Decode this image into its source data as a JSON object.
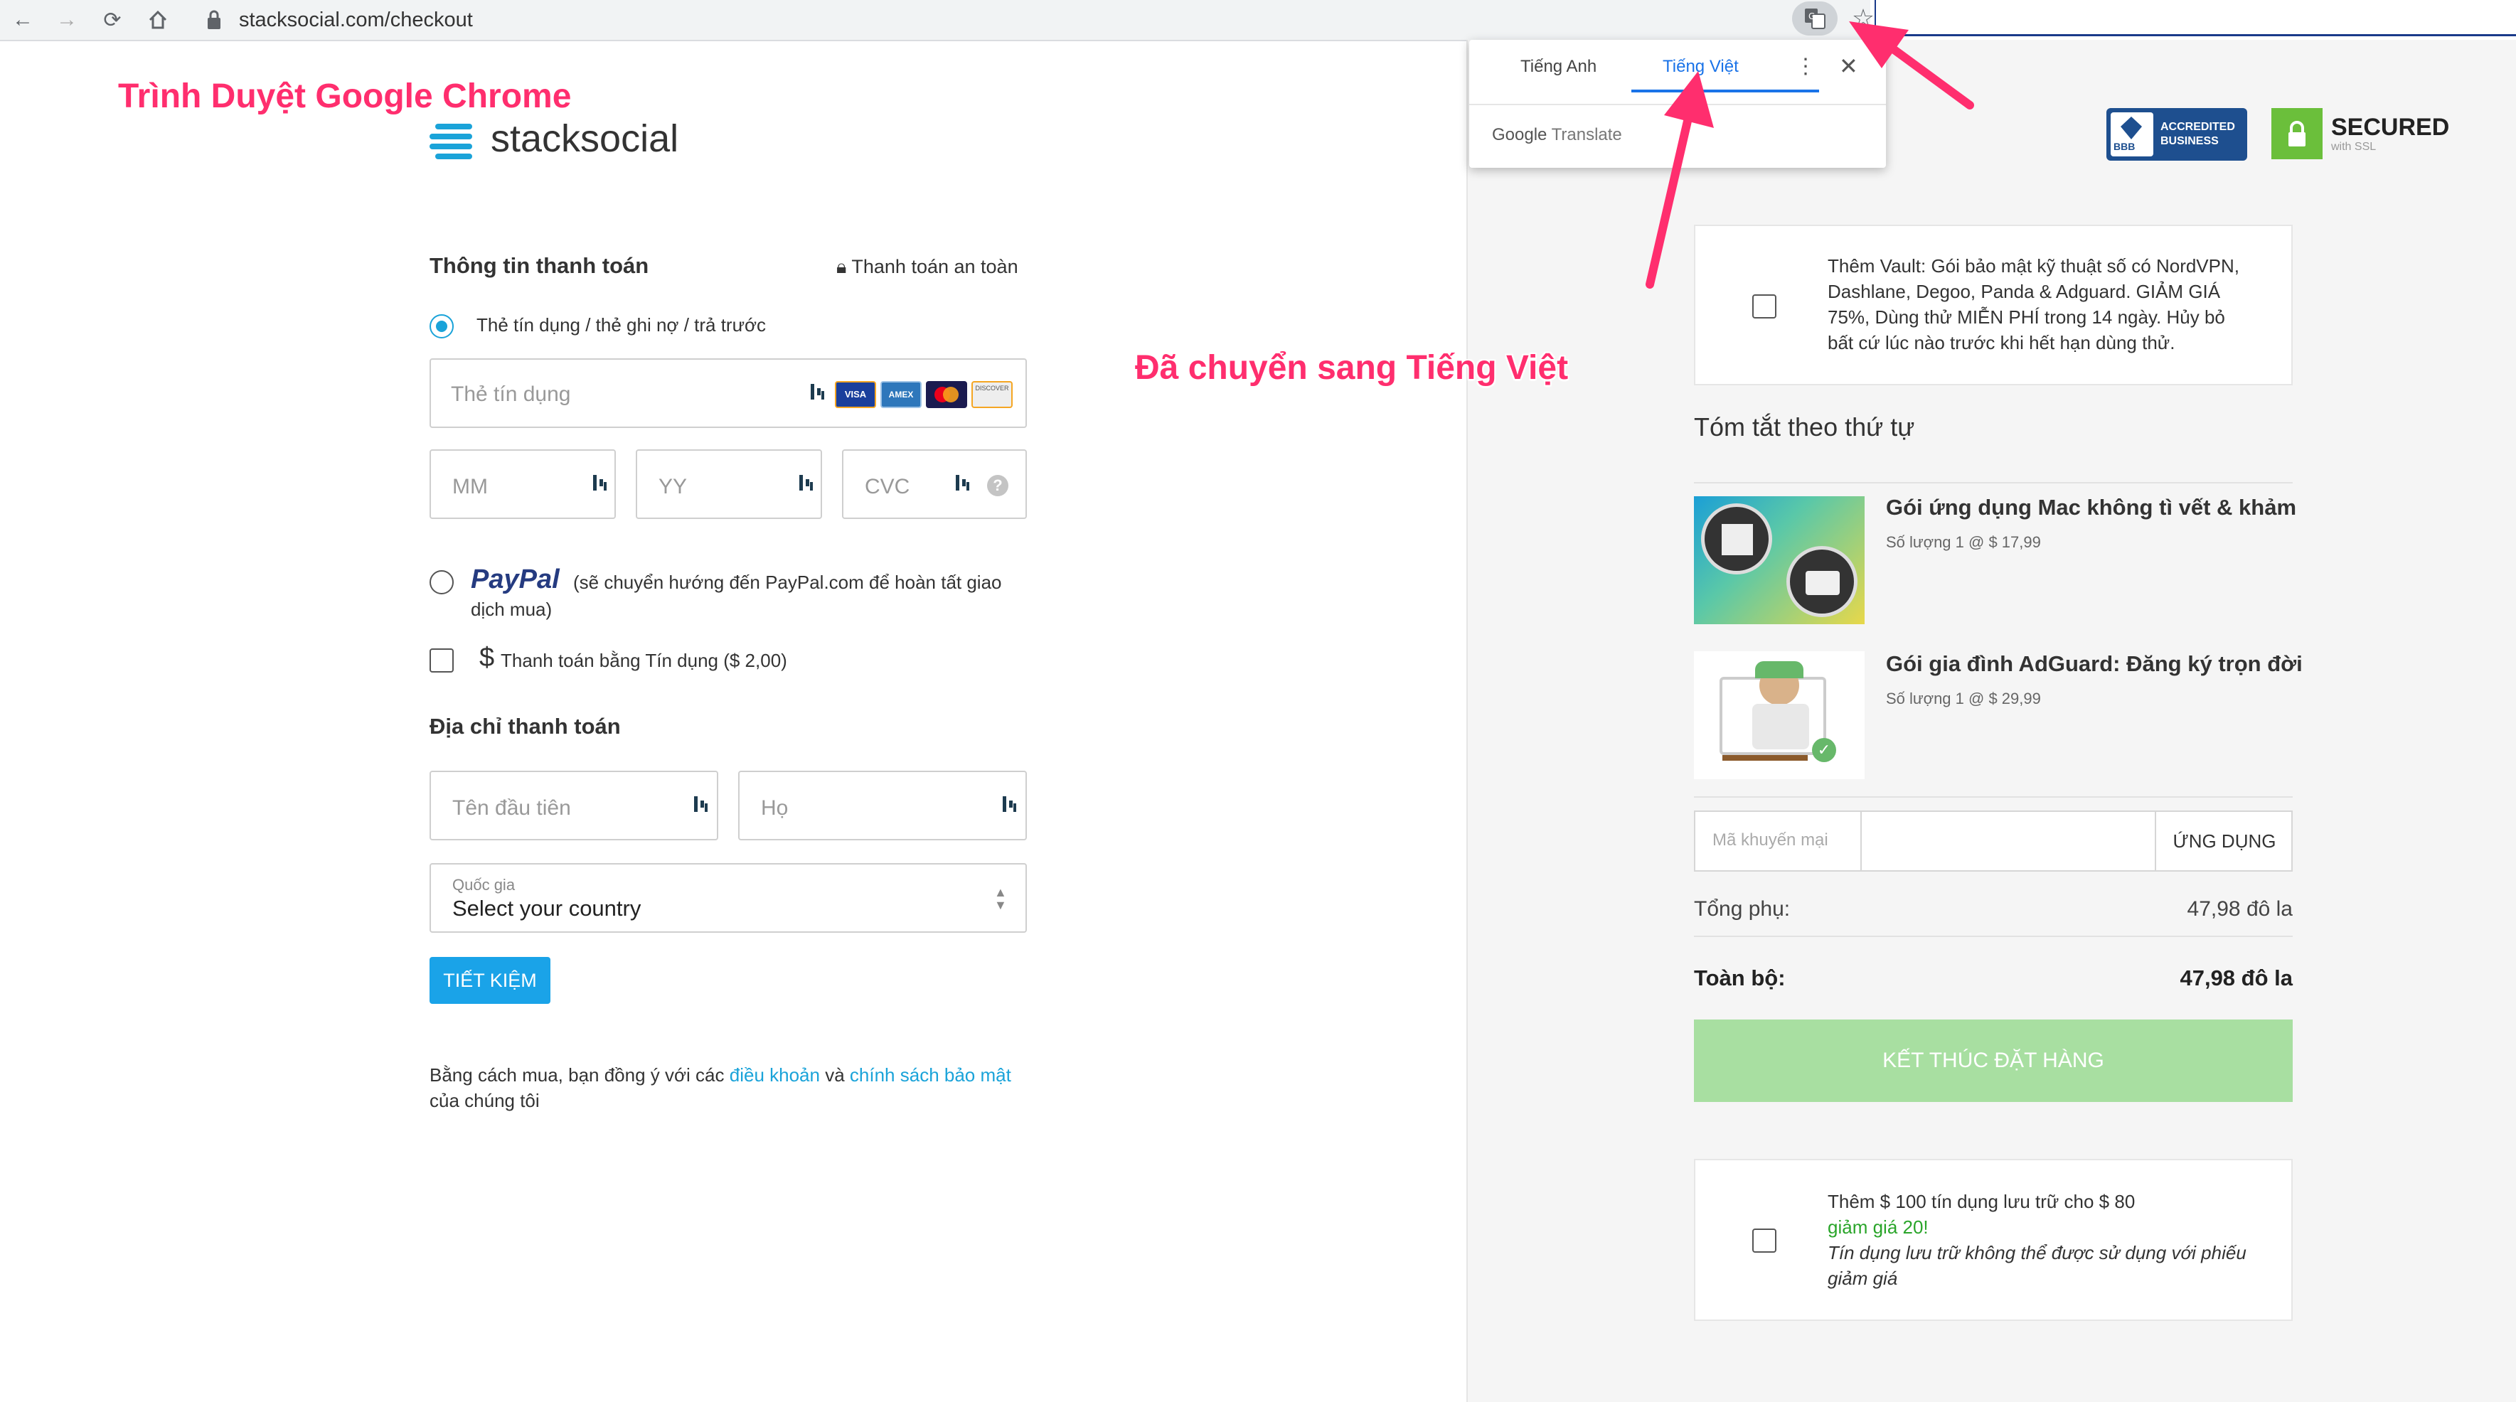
{
  "browser": {
    "url": "stacksocial.com/checkout"
  },
  "translate_popup": {
    "tab_english": "Tiếng Anh",
    "tab_vietnamese": "Tiếng Việt",
    "footer_google": "Google",
    "footer_translate": "Translate"
  },
  "annotations": {
    "browser_label": "Trình Duyệt Google Chrome",
    "switched_label": "Đã chuyển sang Tiếng Việt",
    "accent_color": "#ff2e6e"
  },
  "brand": {
    "logo_text": "stacksocial"
  },
  "badges": {
    "bbb_line1": "ACCREDITED",
    "bbb_line2": "BUSINESS",
    "bbb_mark": "BBB",
    "secured_title": "SECURED",
    "secured_sub": "with SSL"
  },
  "payment": {
    "heading": "Thông tin thanh toán",
    "secure_note": "Thanh toán an toàn",
    "card_option_label": "Thẻ tín dụng / thẻ ghi nợ / trả trước",
    "card_number_placeholder": "Thẻ tín dụng",
    "month_placeholder": "MM",
    "year_placeholder": "YY",
    "cvc_placeholder": "CVC",
    "paypal_logo": "PayPal",
    "paypal_note_line1": "(sẽ chuyển hướng đến PayPal.com để hoàn tất giao",
    "paypal_note_line2": "dịch mua)",
    "credit_option_label": "Thanh toán bằng Tín dụng ($ 2,00)",
    "card_brands": [
      "VISA",
      "AMEX",
      "MC",
      "DISCOVER"
    ]
  },
  "billing": {
    "heading": "Địa chỉ thanh toán",
    "first_name_placeholder": "Tên đầu tiên",
    "last_name_placeholder": "Họ",
    "country_label": "Quốc gia",
    "country_value": "Select your country",
    "save_button": "TIẾT KIỆM"
  },
  "terms": {
    "prefix": "Bằng cách mua, bạn đồng ý với các ",
    "terms_link": "điều khoản",
    "middle": " và ",
    "privacy_link": "chính sách bảo mật",
    "suffix": "của chúng tôi"
  },
  "vault_offer": {
    "text_line1": "Thêm Vault: Gói bảo mật kỹ thuật số có NordVPN,",
    "text_line2": "Dashlane, Degoo, Panda & Adguard. GIẢM GIÁ",
    "text_line3": "75%, Dùng thử MIỄN PHÍ trong 14 ngày. Hủy bỏ",
    "text_line4": "bất cứ lúc nào trước khi hết hạn dùng thử."
  },
  "order_summary": {
    "heading": "Tóm tắt theo thứ tự",
    "items": [
      {
        "name": "Gói ứng dụng Mac không tì vết & khảm",
        "qty": "Số lượng 1 @ $ 17,99"
      },
      {
        "name": "Gói gia đình AdGuard: Đăng ký trọn đời",
        "qty": "Số lượng 1 @ $ 29,99"
      }
    ],
    "promo_placeholder": "Mã khuyến mại",
    "apply_button": "ỨNG DỤNG",
    "subtotal_label": "Tổng phụ:",
    "subtotal_value": "47,98 đô la",
    "total_label": "Toàn bộ:",
    "total_value": "47,98 đô la",
    "checkout_button": "KẾT THÚC ĐẶT HÀNG"
  },
  "store_credit_offer": {
    "line1": "Thêm $ 100 tín dụng lưu trữ cho $ 80",
    "line2": "giảm giá 20!",
    "line3": "Tín dụng lưu trữ không thể được sử dụng với phiếu",
    "line4": "giảm giá"
  }
}
